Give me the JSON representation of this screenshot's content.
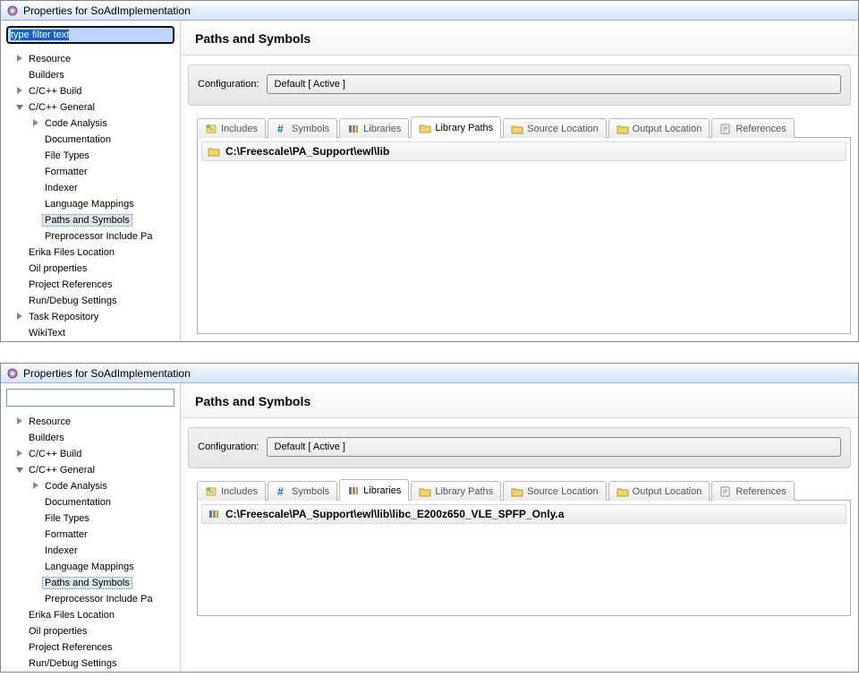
{
  "windows": [
    {
      "title": "Properties for SoAdImplementation",
      "filter_value": "type filter text",
      "filter_selected": true,
      "tree": [
        {
          "lvl": 0,
          "tw": "closed",
          "label": "Resource"
        },
        {
          "lvl": 0,
          "tw": "",
          "label": "Builders"
        },
        {
          "lvl": 0,
          "tw": "closed",
          "label": "C/C++ Build"
        },
        {
          "lvl": 0,
          "tw": "open",
          "label": "C/C++ General"
        },
        {
          "lvl": 1,
          "tw": "closed",
          "label": "Code Analysis"
        },
        {
          "lvl": 1,
          "tw": "",
          "label": "Documentation"
        },
        {
          "lvl": 1,
          "tw": "",
          "label": "File Types"
        },
        {
          "lvl": 1,
          "tw": "",
          "label": "Formatter"
        },
        {
          "lvl": 1,
          "tw": "",
          "label": "Indexer"
        },
        {
          "lvl": 1,
          "tw": "",
          "label": "Language Mappings"
        },
        {
          "lvl": 1,
          "tw": "",
          "label": "Paths and Symbols",
          "sel": true
        },
        {
          "lvl": 1,
          "tw": "",
          "label": "Preprocessor Include Pa"
        },
        {
          "lvl": 0,
          "tw": "",
          "label": "Erika Files Location"
        },
        {
          "lvl": 0,
          "tw": "",
          "label": "Oil properties"
        },
        {
          "lvl": 0,
          "tw": "",
          "label": "Project References"
        },
        {
          "lvl": 0,
          "tw": "",
          "label": "Run/Debug Settings"
        },
        {
          "lvl": 0,
          "tw": "closed",
          "label": "Task Repository"
        },
        {
          "lvl": 0,
          "tw": "",
          "label": "WikiText"
        }
      ],
      "heading": "Paths and Symbols",
      "config_label": "Configuration:",
      "config_selected": "Default  [ Active ]",
      "tabs": [
        {
          "icon": "includes",
          "label": "Includes",
          "active": false
        },
        {
          "icon": "hash",
          "label": "Symbols",
          "active": false
        },
        {
          "icon": "books",
          "label": "Libraries",
          "active": false
        },
        {
          "icon": "folder-lib",
          "label": "Library Paths",
          "active": true
        },
        {
          "icon": "folder-src",
          "label": "Source Location",
          "active": false
        },
        {
          "icon": "folder-out",
          "label": "Output Location",
          "active": false
        },
        {
          "icon": "ref",
          "label": "References",
          "active": false
        }
      ],
      "list": [
        {
          "icon": "folder",
          "text": "C:\\Freescale\\PA_Support\\ewl\\lib"
        }
      ],
      "list_short": false
    },
    {
      "title": "Properties for SoAdImplementation",
      "filter_value": "",
      "filter_selected": false,
      "tree": [
        {
          "lvl": 0,
          "tw": "closed",
          "label": "Resource"
        },
        {
          "lvl": 0,
          "tw": "",
          "label": "Builders"
        },
        {
          "lvl": 0,
          "tw": "closed",
          "label": "C/C++ Build"
        },
        {
          "lvl": 0,
          "tw": "open",
          "label": "C/C++ General"
        },
        {
          "lvl": 1,
          "tw": "closed",
          "label": "Code Analysis"
        },
        {
          "lvl": 1,
          "tw": "",
          "label": "Documentation"
        },
        {
          "lvl": 1,
          "tw": "",
          "label": "File Types"
        },
        {
          "lvl": 1,
          "tw": "",
          "label": "Formatter"
        },
        {
          "lvl": 1,
          "tw": "",
          "label": "Indexer"
        },
        {
          "lvl": 1,
          "tw": "",
          "label": "Language Mappings"
        },
        {
          "lvl": 1,
          "tw": "",
          "label": "Paths and Symbols",
          "sel": true
        },
        {
          "lvl": 1,
          "tw": "",
          "label": "Preprocessor Include Pa"
        },
        {
          "lvl": 0,
          "tw": "",
          "label": "Erika Files Location"
        },
        {
          "lvl": 0,
          "tw": "",
          "label": "Oil properties"
        },
        {
          "lvl": 0,
          "tw": "",
          "label": "Project References"
        },
        {
          "lvl": 0,
          "tw": "",
          "label": "Run/Debug Settings"
        }
      ],
      "heading": "Paths and Symbols",
      "config_label": "Configuration:",
      "config_selected": "Default  [ Active ]",
      "tabs": [
        {
          "icon": "includes",
          "label": "Includes",
          "active": false
        },
        {
          "icon": "hash",
          "label": "Symbols",
          "active": false
        },
        {
          "icon": "books",
          "label": "Libraries",
          "active": true
        },
        {
          "icon": "folder-lib",
          "label": "Library Paths",
          "active": false
        },
        {
          "icon": "folder-src",
          "label": "Source Location",
          "active": false
        },
        {
          "icon": "folder-out",
          "label": "Output Location",
          "active": false
        },
        {
          "icon": "ref",
          "label": "References",
          "active": false
        }
      ],
      "list": [
        {
          "icon": "books",
          "text": "C:\\Freescale\\PA_Support\\ewl\\lib\\libc_E200z650_VLE_SPFP_Only.a"
        }
      ],
      "list_short": true
    }
  ]
}
